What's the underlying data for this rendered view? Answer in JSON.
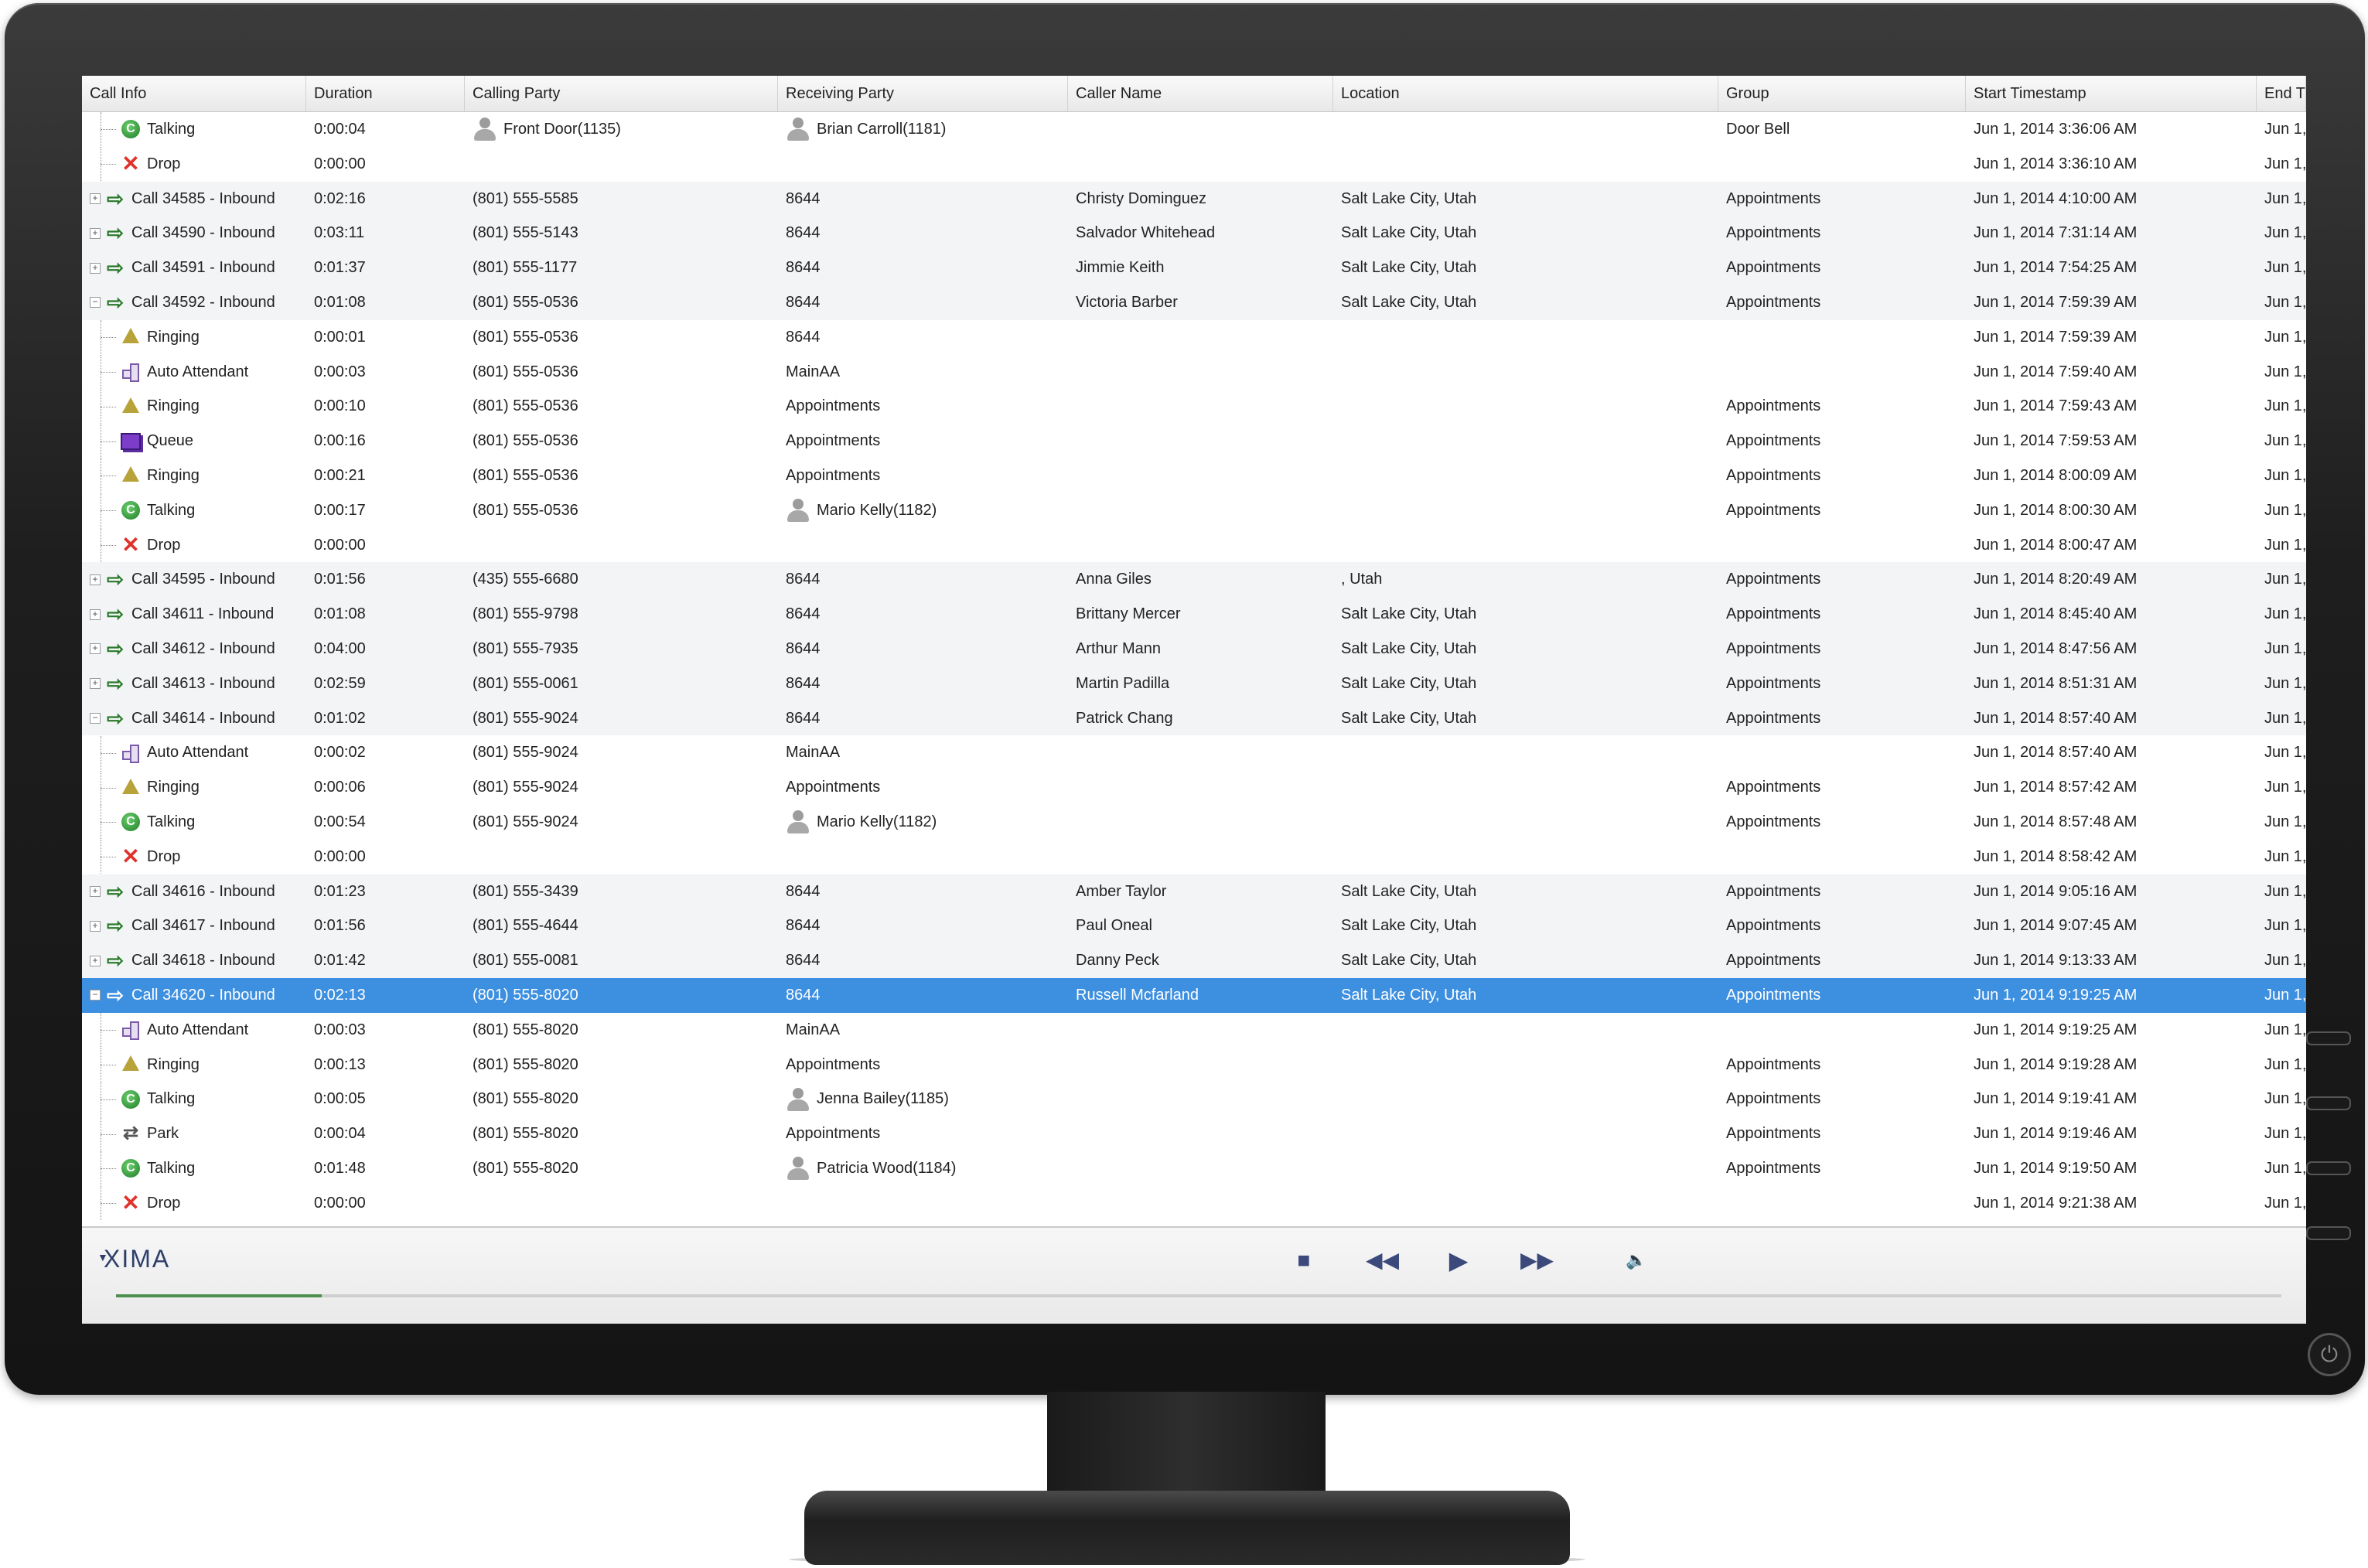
{
  "columns": [
    "Call Info",
    "Duration",
    "Calling Party",
    "Receiving Party",
    "Caller Name",
    "Location",
    "Group",
    "Start Timestamp",
    "End T"
  ],
  "rows": [
    {
      "kind": "child",
      "icon": "talking-icon",
      "info": "Talking",
      "duration": "0:00:04",
      "calling": "Front Door(1135)",
      "calling_avatar": true,
      "receiving": "Brian Carroll(1181)",
      "receiving_avatar": true,
      "caller_name": "",
      "location": "",
      "group": "Door Bell",
      "start": "Jun 1, 2014 3:36:06 AM",
      "end": "Jun 1,"
    },
    {
      "kind": "child",
      "icon": "drop-icon",
      "info": "Drop",
      "duration": "0:00:00",
      "calling": "",
      "receiving": "",
      "caller_name": "",
      "location": "",
      "group": "",
      "start": "Jun 1, 2014 3:36:10 AM",
      "end": "Jun 1,"
    },
    {
      "kind": "parent",
      "expander": "+",
      "info": "Call 34585 - Inbound",
      "duration": "0:02:16",
      "calling": "(801) 555-5585",
      "receiving": "8644",
      "caller_name": "Christy Dominguez",
      "location": "Salt Lake City, Utah",
      "group": "Appointments",
      "start": "Jun 1, 2014 4:10:00 AM",
      "end": "Jun 1,"
    },
    {
      "kind": "parent",
      "expander": "+",
      "info": "Call 34590 - Inbound",
      "duration": "0:03:11",
      "calling": "(801) 555-5143",
      "receiving": "8644",
      "caller_name": "Salvador Whitehead",
      "location": "Salt Lake City, Utah",
      "group": "Appointments",
      "start": "Jun 1, 2014 7:31:14 AM",
      "end": "Jun 1,"
    },
    {
      "kind": "parent",
      "expander": "+",
      "info": "Call 34591 - Inbound",
      "duration": "0:01:37",
      "calling": "(801) 555-1177",
      "receiving": "8644",
      "caller_name": "Jimmie Keith",
      "location": "Salt Lake City, Utah",
      "group": "Appointments",
      "start": "Jun 1, 2014 7:54:25 AM",
      "end": "Jun 1,"
    },
    {
      "kind": "parent",
      "expander": "−",
      "info": "Call 34592 - Inbound",
      "duration": "0:01:08",
      "calling": "(801) 555-0536",
      "receiving": "8644",
      "caller_name": "Victoria Barber",
      "location": "Salt Lake City, Utah",
      "group": "Appointments",
      "start": "Jun 1, 2014 7:59:39 AM",
      "end": "Jun 1,"
    },
    {
      "kind": "child",
      "icon": "ringing-icon",
      "info": "Ringing",
      "duration": "0:00:01",
      "calling": "(801) 555-0536",
      "receiving": "8644",
      "caller_name": "",
      "location": "",
      "group": "",
      "start": "Jun 1, 2014 7:59:39 AM",
      "end": "Jun 1,"
    },
    {
      "kind": "child",
      "icon": "auto-attendant-icon",
      "info": "Auto Attendant",
      "duration": "0:00:03",
      "calling": "(801) 555-0536",
      "receiving": "MainAA",
      "caller_name": "",
      "location": "",
      "group": "",
      "start": "Jun 1, 2014 7:59:40 AM",
      "end": "Jun 1,"
    },
    {
      "kind": "child",
      "icon": "ringing-icon",
      "info": "Ringing",
      "duration": "0:00:10",
      "calling": "(801) 555-0536",
      "receiving": "Appointments",
      "caller_name": "",
      "location": "",
      "group": "Appointments",
      "start": "Jun 1, 2014 7:59:43 AM",
      "end": "Jun 1,"
    },
    {
      "kind": "child",
      "icon": "queue-icon",
      "info": "Queue",
      "duration": "0:00:16",
      "calling": "(801) 555-0536",
      "receiving": "Appointments",
      "caller_name": "",
      "location": "",
      "group": "Appointments",
      "start": "Jun 1, 2014 7:59:53 AM",
      "end": "Jun 1,"
    },
    {
      "kind": "child",
      "icon": "ringing-icon",
      "info": "Ringing",
      "duration": "0:00:21",
      "calling": "(801) 555-0536",
      "receiving": "Appointments",
      "caller_name": "",
      "location": "",
      "group": "Appointments",
      "start": "Jun 1, 2014 8:00:09 AM",
      "end": "Jun 1,"
    },
    {
      "kind": "child",
      "icon": "talking-icon",
      "info": "Talking",
      "duration": "0:00:17",
      "calling": "(801) 555-0536",
      "receiving": "Mario Kelly(1182)",
      "receiving_avatar": true,
      "caller_name": "",
      "location": "",
      "group": "Appointments",
      "start": "Jun 1, 2014 8:00:30 AM",
      "end": "Jun 1,"
    },
    {
      "kind": "child",
      "icon": "drop-icon",
      "info": "Drop",
      "duration": "0:00:00",
      "calling": "",
      "receiving": "",
      "caller_name": "",
      "location": "",
      "group": "",
      "start": "Jun 1, 2014 8:00:47 AM",
      "end": "Jun 1,"
    },
    {
      "kind": "parent",
      "expander": "+",
      "info": "Call 34595 - Inbound",
      "duration": "0:01:56",
      "calling": "(435) 555-6680",
      "receiving": "8644",
      "caller_name": "Anna Giles",
      "location": ", Utah",
      "group": "Appointments",
      "start": "Jun 1, 2014 8:20:49 AM",
      "end": "Jun 1,"
    },
    {
      "kind": "parent",
      "expander": "+",
      "info": "Call 34611 - Inbound",
      "duration": "0:01:08",
      "calling": "(801) 555-9798",
      "receiving": "8644",
      "caller_name": "Brittany Mercer",
      "location": "Salt Lake City, Utah",
      "group": "Appointments",
      "start": "Jun 1, 2014 8:45:40 AM",
      "end": "Jun 1,"
    },
    {
      "kind": "parent",
      "expander": "+",
      "info": "Call 34612 - Inbound",
      "duration": "0:04:00",
      "calling": "(801) 555-7935",
      "receiving": "8644",
      "caller_name": "Arthur Mann",
      "location": "Salt Lake City, Utah",
      "group": "Appointments",
      "start": "Jun 1, 2014 8:47:56 AM",
      "end": "Jun 1,"
    },
    {
      "kind": "parent",
      "expander": "+",
      "info": "Call 34613 - Inbound",
      "duration": "0:02:59",
      "calling": "(801) 555-0061",
      "receiving": "8644",
      "caller_name": "Martin Padilla",
      "location": "Salt Lake City, Utah",
      "group": "Appointments",
      "start": "Jun 1, 2014 8:51:31 AM",
      "end": "Jun 1,"
    },
    {
      "kind": "parent",
      "expander": "−",
      "info": "Call 34614 - Inbound",
      "duration": "0:01:02",
      "calling": "(801) 555-9024",
      "receiving": "8644",
      "caller_name": "Patrick Chang",
      "location": "Salt Lake City, Utah",
      "group": "Appointments",
      "start": "Jun 1, 2014 8:57:40 AM",
      "end": "Jun 1,"
    },
    {
      "kind": "child",
      "icon": "auto-attendant-icon",
      "info": "Auto Attendant",
      "duration": "0:00:02",
      "calling": "(801) 555-9024",
      "receiving": "MainAA",
      "caller_name": "",
      "location": "",
      "group": "",
      "start": "Jun 1, 2014 8:57:40 AM",
      "end": "Jun 1,"
    },
    {
      "kind": "child",
      "icon": "ringing-icon",
      "info": "Ringing",
      "duration": "0:00:06",
      "calling": "(801) 555-9024",
      "receiving": "Appointments",
      "caller_name": "",
      "location": "",
      "group": "Appointments",
      "start": "Jun 1, 2014 8:57:42 AM",
      "end": "Jun 1,"
    },
    {
      "kind": "child",
      "icon": "talking-icon",
      "info": "Talking",
      "duration": "0:00:54",
      "calling": "(801) 555-9024",
      "receiving": "Mario Kelly(1182)",
      "receiving_avatar": true,
      "caller_name": "",
      "location": "",
      "group": "Appointments",
      "start": "Jun 1, 2014 8:57:48 AM",
      "end": "Jun 1,"
    },
    {
      "kind": "child",
      "icon": "drop-icon",
      "info": "Drop",
      "duration": "0:00:00",
      "calling": "",
      "receiving": "",
      "caller_name": "",
      "location": "",
      "group": "",
      "start": "Jun 1, 2014 8:58:42 AM",
      "end": "Jun 1,"
    },
    {
      "kind": "parent",
      "expander": "+",
      "info": "Call 34616 - Inbound",
      "duration": "0:01:23",
      "calling": "(801) 555-3439",
      "receiving": "8644",
      "caller_name": "Amber Taylor",
      "location": "Salt Lake City, Utah",
      "group": "Appointments",
      "start": "Jun 1, 2014 9:05:16 AM",
      "end": "Jun 1,"
    },
    {
      "kind": "parent",
      "expander": "+",
      "info": "Call 34617 - Inbound",
      "duration": "0:01:56",
      "calling": "(801) 555-4644",
      "receiving": "8644",
      "caller_name": "Paul Oneal",
      "location": "Salt Lake City, Utah",
      "group": "Appointments",
      "start": "Jun 1, 2014 9:07:45 AM",
      "end": "Jun 1,"
    },
    {
      "kind": "parent",
      "expander": "+",
      "info": "Call 34618 - Inbound",
      "duration": "0:01:42",
      "calling": "(801) 555-0081",
      "receiving": "8644",
      "caller_name": "Danny Peck",
      "location": "Salt Lake City, Utah",
      "group": "Appointments",
      "start": "Jun 1, 2014 9:13:33 AM",
      "end": "Jun 1,"
    },
    {
      "kind": "parent",
      "expander": "−",
      "selected": true,
      "info": "Call 34620 - Inbound",
      "duration": "0:02:13",
      "calling": "(801) 555-8020",
      "receiving": "8644",
      "caller_name": "Russell Mcfarland",
      "location": "Salt Lake City, Utah",
      "group": "Appointments",
      "start": "Jun 1, 2014 9:19:25 AM",
      "end": "Jun 1,"
    },
    {
      "kind": "child",
      "icon": "auto-attendant-icon",
      "info": "Auto Attendant",
      "duration": "0:00:03",
      "calling": "(801) 555-8020",
      "receiving": "MainAA",
      "caller_name": "",
      "location": "",
      "group": "",
      "start": "Jun 1, 2014 9:19:25 AM",
      "end": "Jun 1,"
    },
    {
      "kind": "child",
      "icon": "ringing-icon",
      "info": "Ringing",
      "duration": "0:00:13",
      "calling": "(801) 555-8020",
      "receiving": "Appointments",
      "caller_name": "",
      "location": "",
      "group": "Appointments",
      "start": "Jun 1, 2014 9:19:28 AM",
      "end": "Jun 1,"
    },
    {
      "kind": "child",
      "icon": "talking-icon",
      "info": "Talking",
      "duration": "0:00:05",
      "calling": "(801) 555-8020",
      "receiving": "Jenna Bailey(1185)",
      "receiving_avatar": true,
      "caller_name": "",
      "location": "",
      "group": "Appointments",
      "start": "Jun 1, 2014 9:19:41 AM",
      "end": "Jun 1,"
    },
    {
      "kind": "child",
      "icon": "park-icon",
      "info": "Park",
      "duration": "0:00:04",
      "calling": "(801) 555-8020",
      "receiving": "Appointments",
      "caller_name": "",
      "location": "",
      "group": "Appointments",
      "start": "Jun 1, 2014 9:19:46 AM",
      "end": "Jun 1,"
    },
    {
      "kind": "child",
      "icon": "talking-icon",
      "info": "Talking",
      "duration": "0:01:48",
      "calling": "(801) 555-8020",
      "receiving": "Patricia Wood(1184)",
      "receiving_avatar": true,
      "caller_name": "",
      "location": "",
      "group": "Appointments",
      "start": "Jun 1, 2014 9:19:50 AM",
      "end": "Jun 1,"
    },
    {
      "kind": "child",
      "icon": "drop-icon",
      "info": "Drop",
      "duration": "0:00:00",
      "calling": "",
      "receiving": "",
      "caller_name": "",
      "location": "",
      "group": "",
      "start": "Jun 1, 2014 9:21:38 AM",
      "end": "Jun 1,"
    }
  ],
  "player": {
    "logo": "XIMA",
    "progress": 0.095,
    "controls": [
      "stop-icon",
      "rewind-icon",
      "play-icon",
      "fast-forward-icon",
      "volume-icon"
    ]
  },
  "colors": {
    "selected_row": "#3d8fe0",
    "parent_row": "#f3f4f6",
    "logo": "#2f3f6a",
    "progress": "#4d8f4d"
  }
}
